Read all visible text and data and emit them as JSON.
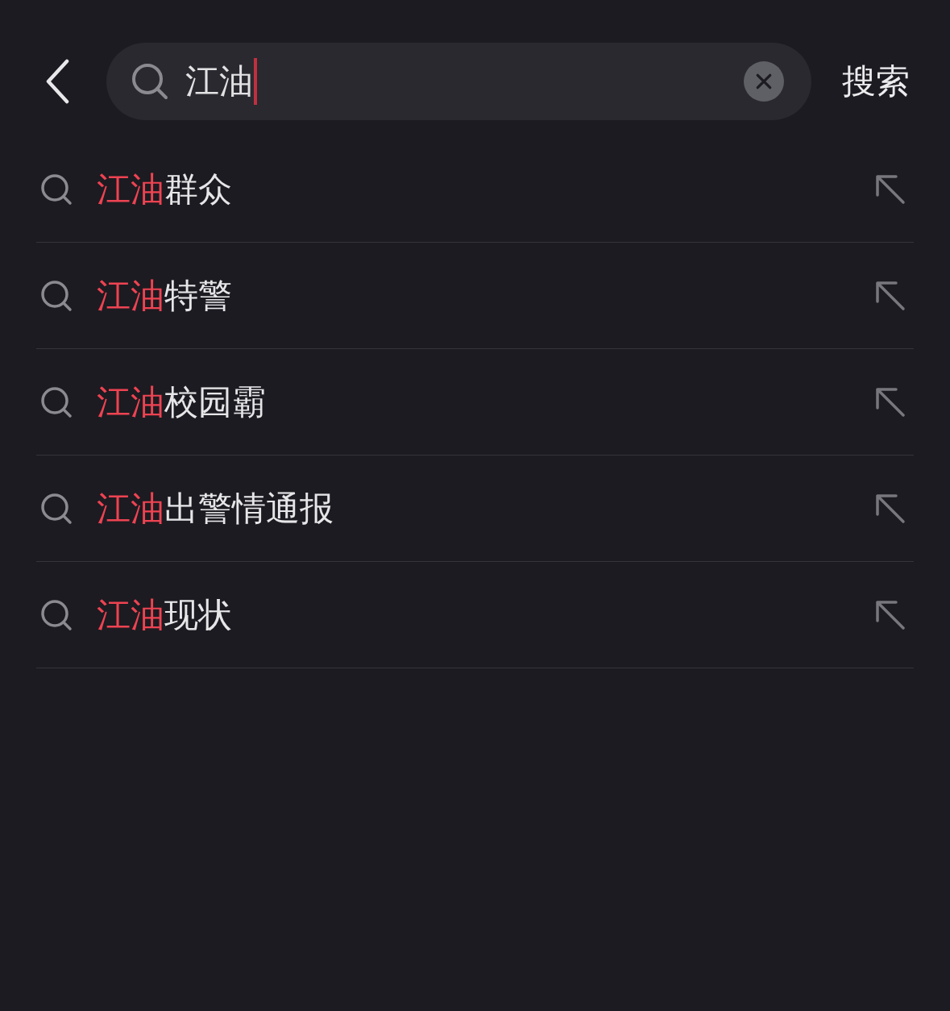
{
  "search": {
    "value": "江油",
    "submit": "搜索"
  },
  "suggestions": [
    {
      "match": "江油",
      "rest": "群众"
    },
    {
      "match": "江油",
      "rest": "特警"
    },
    {
      "match": "江油",
      "rest": "校园霸"
    },
    {
      "match": "江油",
      "rest": "出警情通报"
    },
    {
      "match": "江油",
      "rest": "现状"
    }
  ]
}
